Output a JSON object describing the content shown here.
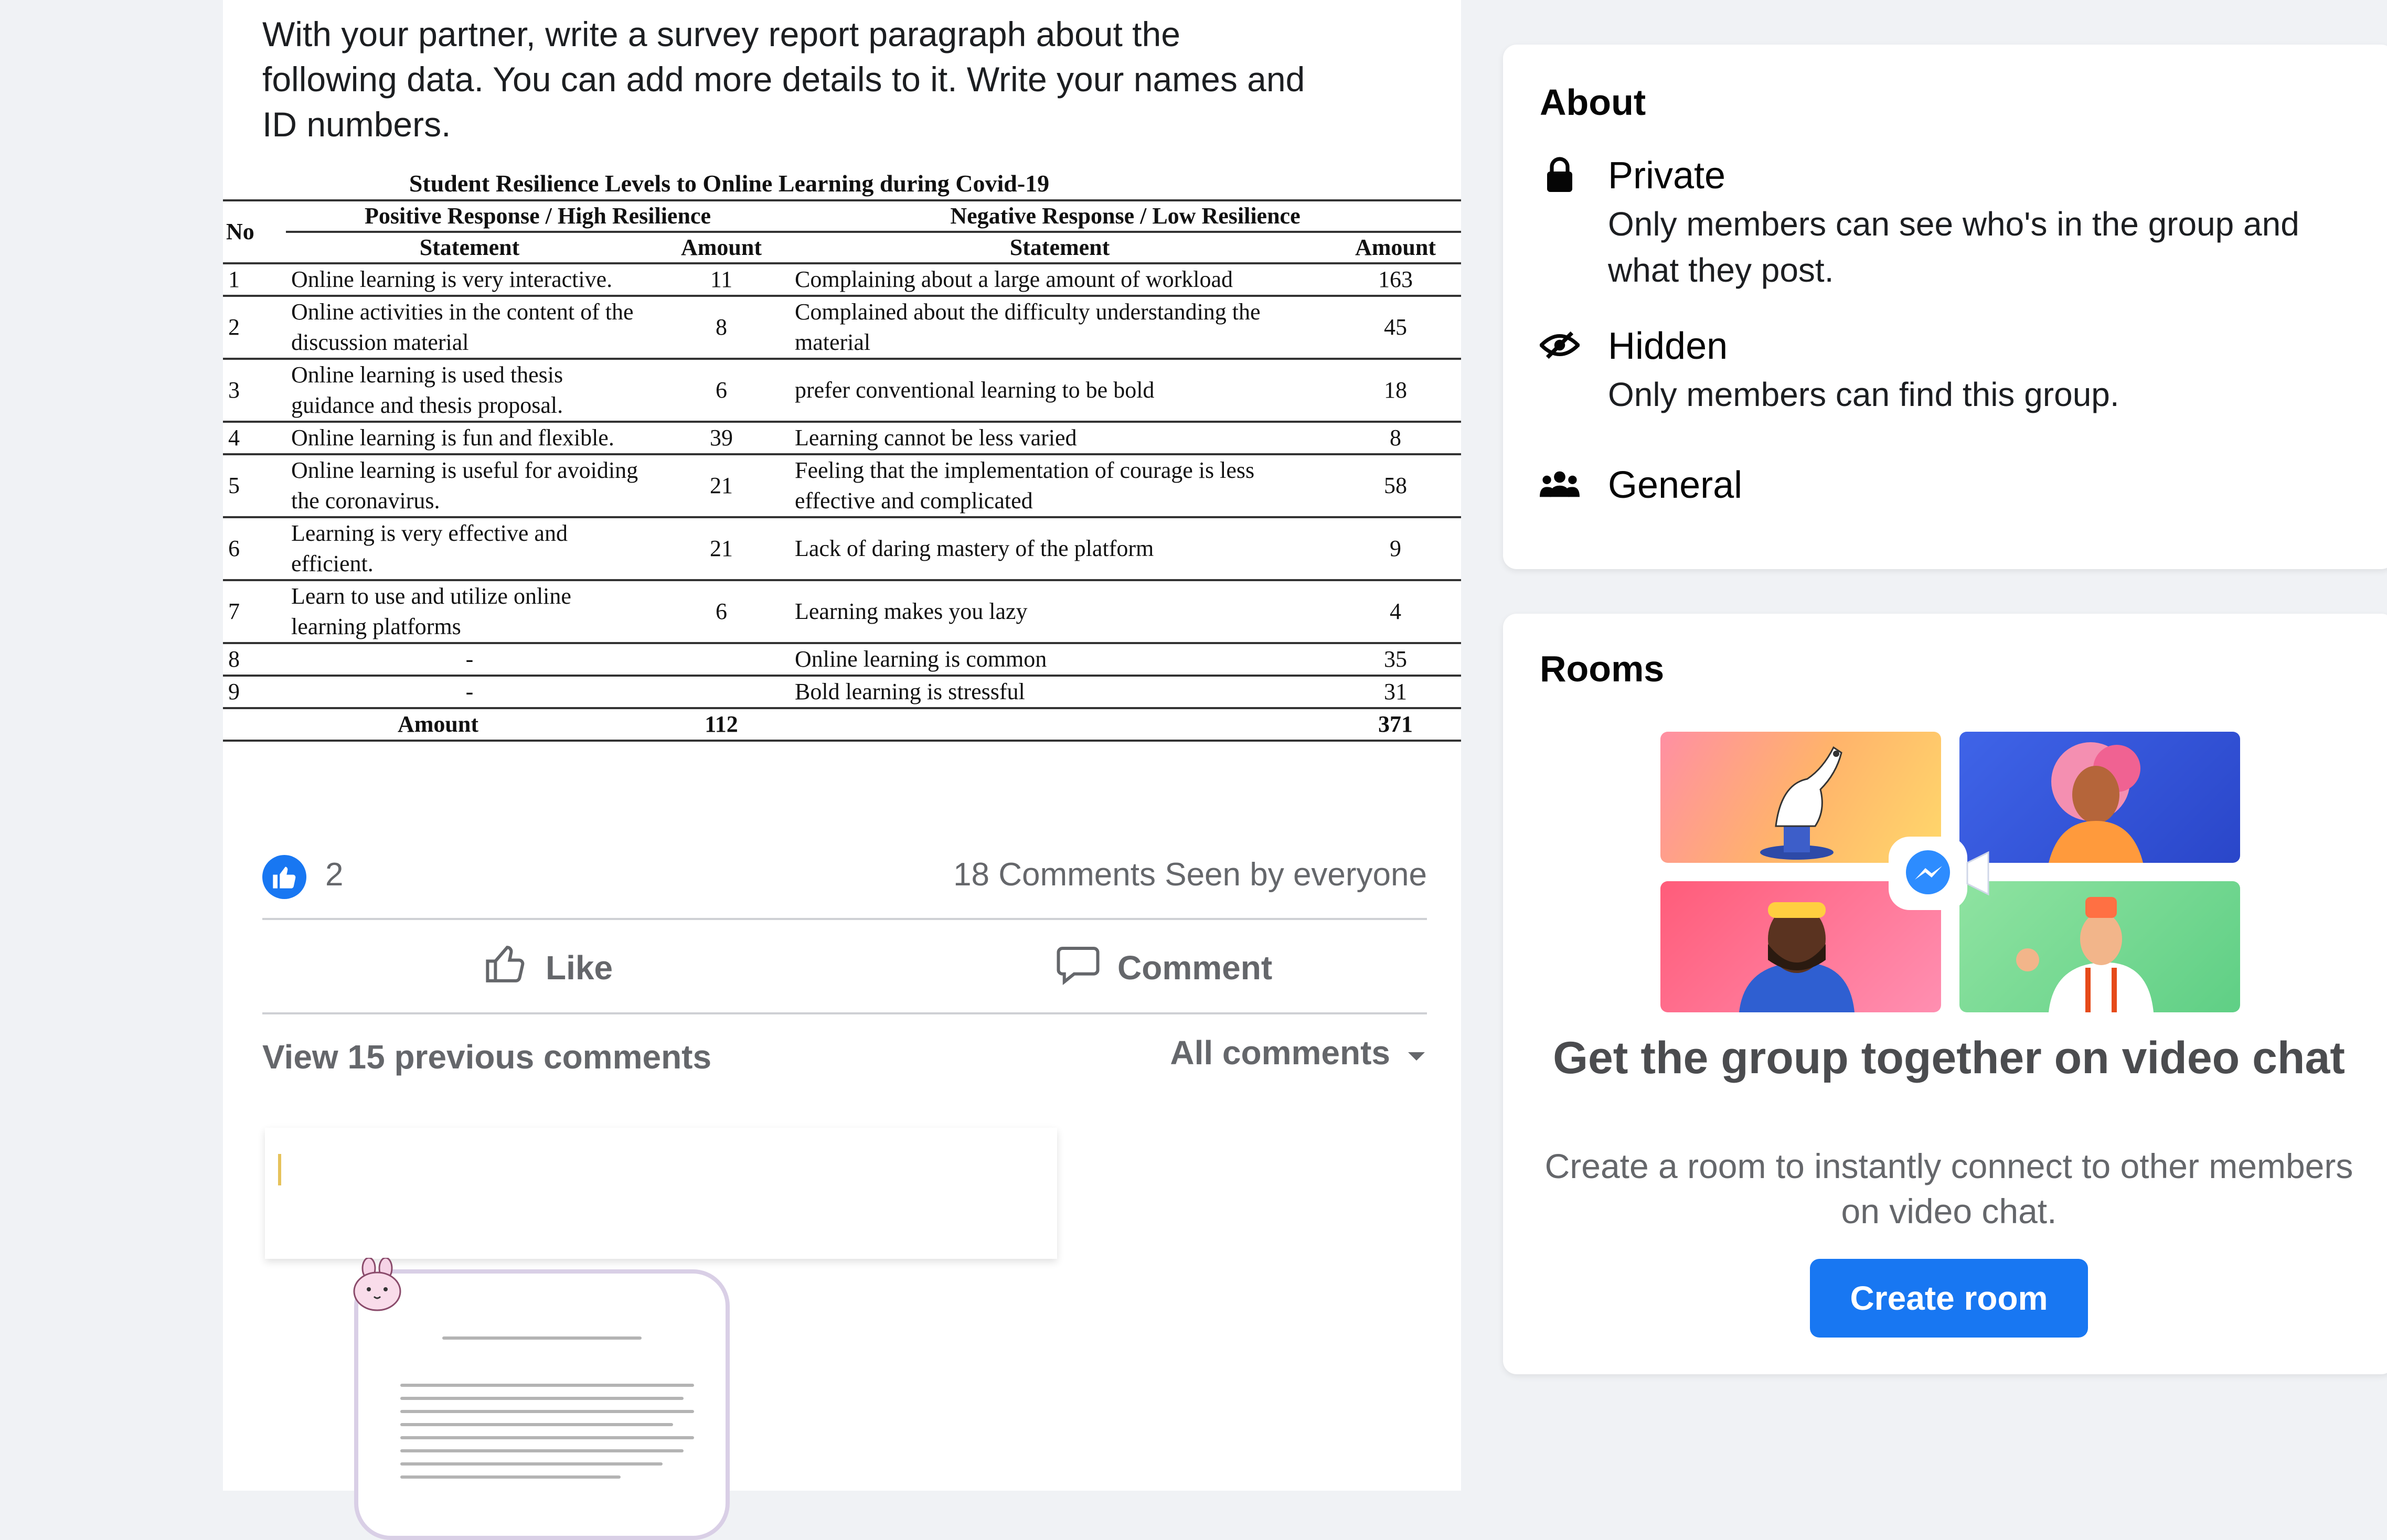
{
  "post": {
    "text": "With your partner, write a survey report paragraph about the\nfollowing data. You can add more details to it. Write your names and\nID numbers.",
    "table": {
      "title": "Student Resilience Levels to Online Learning during Covid-19",
      "col_no": "No",
      "positive_header": "Positive Response / High Resilience",
      "negative_header": "Negative Response / Low Resilience",
      "statement_header": "Statement",
      "amount_header": "Amount",
      "rows": [
        {
          "no": "1",
          "pos_statement": "Online learning is very interactive.",
          "pos_amount": "11",
          "neg_statement": "Complaining about a large amount of workload",
          "neg_amount": "163"
        },
        {
          "no": "2",
          "pos_statement": "Online activities in the content of the discussion material",
          "pos_amount": "8",
          "neg_statement": "Complained about the difficulty understanding the material",
          "neg_amount": "45"
        },
        {
          "no": "3",
          "pos_statement": "Online learning is used thesis guidance and thesis proposal.",
          "pos_amount": "6",
          "neg_statement": "prefer conventional learning to be bold",
          "neg_amount": "18"
        },
        {
          "no": "4",
          "pos_statement": "Online learning is fun and flexible.",
          "pos_amount": "39",
          "neg_statement": "Learning cannot be less varied",
          "neg_amount": "8"
        },
        {
          "no": "5",
          "pos_statement": "Online learning is useful for avoiding the coronavirus.",
          "pos_amount": "21",
          "neg_statement": "Feeling that the implementation of courage is less effective and complicated",
          "neg_amount": "58"
        },
        {
          "no": "6",
          "pos_statement": "Learning is very effective and efficient.",
          "pos_amount": "21",
          "neg_statement": "Lack of daring mastery of the platform",
          "neg_amount": "9"
        },
        {
          "no": "7",
          "pos_statement": "Learn to use and utilize online learning platforms",
          "pos_amount": "6",
          "neg_statement": "Learning makes you lazy",
          "neg_amount": "4"
        },
        {
          "no": "8",
          "pos_statement": "-",
          "pos_amount": "",
          "neg_statement": "Online learning is common",
          "neg_amount": "35"
        },
        {
          "no": "9",
          "pos_statement": "-",
          "pos_amount": "",
          "neg_statement": "Bold learning is stressful",
          "neg_amount": "31"
        }
      ],
      "total_label": "Amount",
      "pos_total": "112",
      "neg_total": "371"
    },
    "like_count": "2",
    "stats": "18 Comments  Seen by everyone",
    "like_label": "Like",
    "comment_label": "Comment",
    "view_previous": "View 15 previous comments",
    "all_comments": "All comments"
  },
  "about": {
    "title": "About",
    "items": [
      {
        "icon": "lock-icon",
        "label": "Private",
        "desc": "Only members can see who's in the group and what they post."
      },
      {
        "icon": "hidden-eye-icon",
        "label": "Hidden",
        "desc": "Only members can find this group."
      },
      {
        "icon": "people-icon",
        "label": "General",
        "desc": ""
      }
    ]
  },
  "rooms": {
    "title": "Rooms",
    "headline": "Get the group together on video chat",
    "subtitle": "Create a room to instantly connect to other members on video chat.",
    "button": "Create room"
  },
  "colors": {
    "accent": "#1877f2",
    "secondary_text": "#65676b",
    "page_bg": "#f0f2f5"
  }
}
